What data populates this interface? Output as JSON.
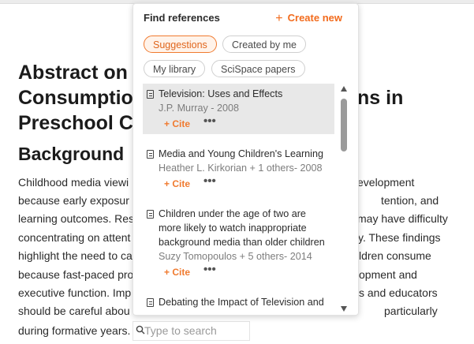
{
  "document": {
    "title_lines": [
      "Abstract on",
      "Consumptio",
      "Preschool C"
    ],
    "title_right_fragment": "ns in",
    "heading": "Background",
    "body_left": [
      "Childhood media viewi",
      "because early exposur",
      "learning outcomes. Res",
      "concentrating on attent",
      "highlight the need to ca",
      "because fast-paced pro",
      "executive function. Imp",
      "should be careful abou",
      "during formative years."
    ],
    "body_right": [
      "evelopment",
      "tention, and",
      "may have difficulty",
      "y. These findings",
      "ldren consume",
      "opment and",
      "s and educators",
      "particularly",
      ""
    ]
  },
  "search": {
    "placeholder": "Type to search",
    "value": ""
  },
  "popup": {
    "title": "Find references",
    "create_label": "Create new",
    "create_icon": "plus-icon",
    "filters": [
      {
        "label": "Suggestions",
        "active": true
      },
      {
        "label": "Created by me",
        "active": false
      },
      {
        "label": "My library",
        "active": false
      },
      {
        "label": "SciSpace papers",
        "active": false
      }
    ],
    "references": [
      {
        "title": "Television: Uses and Effects",
        "meta": "J.P. Murray - 2008",
        "cite": "+ Cite",
        "more": "•••",
        "selected": true
      },
      {
        "title": "Media and Young Children's Learning",
        "meta": "Heather L. Kirkorian + 1 others- 2008",
        "cite": "+ Cite",
        "more": "•••",
        "selected": false
      },
      {
        "title": "Children under the age of two are more likely to watch inappropriate background media than older children",
        "meta": "Suzy Tomopoulos + 5 others- 2014",
        "cite": "+ Cite",
        "more": "•••",
        "selected": false
      },
      {
        "title": "Debating the Impact of Television and",
        "meta": "",
        "cite": "",
        "more": "",
        "selected": false
      }
    ]
  },
  "colors": {
    "accent": "#f26b1d",
    "selected_bg": "#e8e8e8"
  }
}
